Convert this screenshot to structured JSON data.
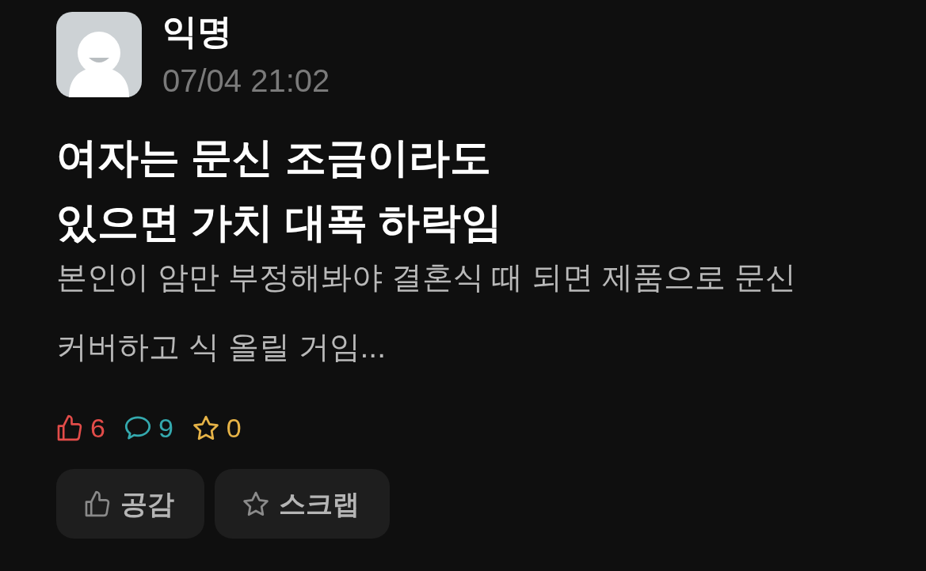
{
  "post": {
    "author": {
      "name": "익명",
      "time": "07/04 21:02"
    },
    "title": "여자는 문신 조금이라도 있으면 가치 대폭 하락임",
    "body": "본인이 암만 부정해봐야 결혼식 때 되면 제품으로 문신 커버하고 식 올릴 거임...",
    "stats": [
      {
        "kind": "like",
        "count": "6",
        "color": "#e24c49"
      },
      {
        "kind": "comment",
        "count": "9",
        "color": "#34a9ae"
      },
      {
        "kind": "scrap",
        "count": "0",
        "color": "#e6b347"
      }
    ],
    "actions": [
      {
        "kind": "like",
        "label": "공감"
      },
      {
        "kind": "scrap",
        "label": "스크랩"
      }
    ]
  }
}
